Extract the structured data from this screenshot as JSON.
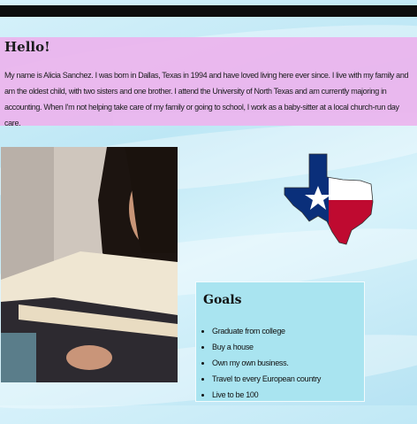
{
  "intro": {
    "heading": "Hello!",
    "paragraph": "My name is Alicia Sanchez. I was born in Dallas, Texas in 1994 and have loved living here ever since. I live with my family and am the oldest child, with two sisters and one brother. I attend the University of North Texas and am currently majoring in accounting. When I'm not helping take care of my family or going to school, I work as a baby-sitter at a local church-run day care."
  },
  "goals": {
    "heading": "Goals",
    "items": [
      "Graduate from college",
      "Buy a house",
      "Own my own business.",
      "Travel to every European country",
      "Live to be 100"
    ]
  },
  "colors": {
    "intro_background": "#ebb6ee",
    "goals_background": "#a9e4f0",
    "top_bar": "#0d0d0d",
    "flag_blue": "#0a2f7a",
    "flag_red": "#bf0a30"
  }
}
